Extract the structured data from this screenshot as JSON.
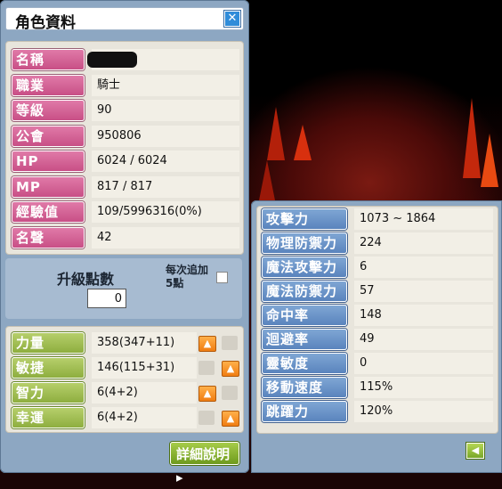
{
  "window": {
    "title": "角色資料",
    "close_icon": "close-x-icon"
  },
  "profile": [
    {
      "label": "名稱",
      "value": ""
    },
    {
      "label": "職業",
      "value": "騎士"
    },
    {
      "label": "等級",
      "value": "90"
    },
    {
      "label": "公會",
      "value": "950806"
    },
    {
      "label": "HP",
      "value": "6024 / 6024"
    },
    {
      "label": "MP",
      "value": "817 / 817"
    },
    {
      "label": "經驗值",
      "value": "109/5996316(0%)"
    },
    {
      "label": "名聲",
      "value": "42"
    }
  ],
  "ability_points": {
    "label": "升級點數",
    "value": "0",
    "auto_add_label": "每次追加5點"
  },
  "stats": [
    {
      "label": "力量",
      "value": "358(347+11)"
    },
    {
      "label": "敏捷",
      "value": "146(115+31)"
    },
    {
      "label": "智力",
      "value": "6(4+2)"
    },
    {
      "label": "幸運",
      "value": "6(4+2)"
    }
  ],
  "detail_button": "詳細說明",
  "detail_stats": [
    {
      "label": "攻擊力",
      "value": "1073 ~ 1864"
    },
    {
      "label": "物理防禦力",
      "value": "224"
    },
    {
      "label": "魔法攻擊力",
      "value": "6"
    },
    {
      "label": "魔法防禦力",
      "value": "57"
    },
    {
      "label": "命中率",
      "value": "148"
    },
    {
      "label": "迴避率",
      "value": "49"
    },
    {
      "label": "靈敏度",
      "value": "0"
    },
    {
      "label": "移動速度",
      "value": "115%"
    },
    {
      "label": "跳躍力",
      "value": "120%"
    }
  ],
  "colors": {
    "label_pink": "#d2609a",
    "label_green": "#9bba4d",
    "label_blue": "#6890c6",
    "window_blue": "#8da7c2",
    "arrow_orange": "#f59020"
  }
}
